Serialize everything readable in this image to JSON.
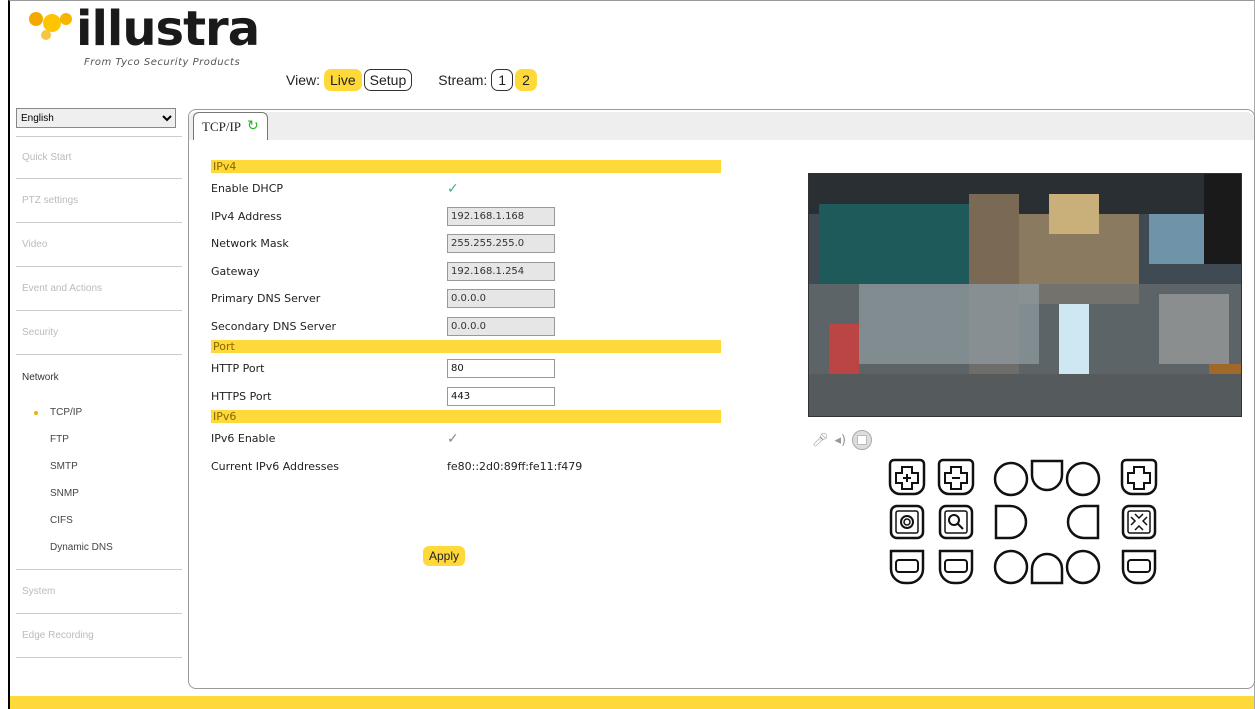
{
  "brand": {
    "name": "illustra",
    "tagline": "From Tyco Security Products",
    "accent": "#ffd83a"
  },
  "viewbar": {
    "view_label": "View:",
    "view_live": "Live",
    "view_setup": "Setup",
    "stream_label": "Stream:",
    "stream_1": "1",
    "stream_2": "2"
  },
  "sidebar": {
    "language": "English",
    "sections": [
      "Quick Start",
      "PTZ settings",
      "Video",
      "Event and Actions",
      "Security"
    ],
    "network": {
      "title": "Network",
      "items": [
        "TCP/IP",
        "FTP",
        "SMTP",
        "SNMP",
        "CIFS",
        "Dynamic DNS"
      ],
      "active": "TCP/IP"
    },
    "after": [
      "System",
      "Edge Recording"
    ]
  },
  "tab": {
    "label": "TCP/IP",
    "refresh_icon": "refresh-icon"
  },
  "form": {
    "ipv4_header": "IPv4",
    "enable_dhcp_label": "Enable DHCP",
    "enable_dhcp_checked": true,
    "ipv4_address_label": "IPv4 Address",
    "ipv4_address": "192.168.1.168",
    "network_mask_label": "Network Mask",
    "network_mask": "255.255.255.0",
    "gateway_label": "Gateway",
    "gateway": "192.168.1.254",
    "primary_dns_label": "Primary DNS Server",
    "primary_dns": "0.0.0.0",
    "secondary_dns_label": "Secondary DNS Server",
    "secondary_dns": "0.0.0.0",
    "port_header": "Port",
    "http_port_label": "HTTP Port",
    "http_port": "80",
    "https_port_label": "HTTPS Port",
    "https_port": "443",
    "ipv6_header": "IPv6",
    "ipv6_enable_label": "IPv6 Enable",
    "ipv6_enable_checked": true,
    "current_ipv6_label": "Current IPv6 Addresses",
    "current_ipv6": "fe80::2d0:89ff:fe11:f479",
    "apply_label": "Apply"
  },
  "video_controls": [
    "microphone-icon",
    "speaker-icon",
    "stop-icon"
  ],
  "ptz_buttons": [
    "zoom-in-icon",
    "zoom-out-icon",
    "ptz-upleft-icon",
    "ptz-up-icon",
    "ptz-upright-icon",
    "focus-near-icon",
    "iris-icon",
    "focus-icon",
    "ptz-left-icon",
    "ptz-right-icon",
    "auto-focus-icon",
    "iris-open-icon",
    "iris-close-icon",
    "ptz-downleft-icon",
    "ptz-down-icon",
    "ptz-downright-icon",
    "preset-icon"
  ]
}
